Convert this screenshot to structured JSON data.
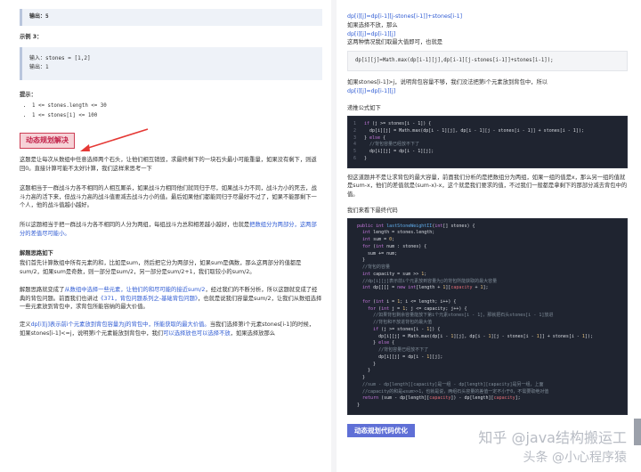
{
  "left": {
    "output5": "输出：5",
    "example3_title": "示例 3：",
    "example3_input": "输入：stones = [1,2]",
    "example3_output": "输出：1",
    "hint_title": "提示：",
    "hints": [
      "1 <= stones.length <= 30",
      "1 <= stones[i] <= 100"
    ],
    "section_title": "动态规划解决",
    "para1": "这题是让每次从数组中任意选择两个石头，让他们相互销毁，求最终剩下的一块石头最小可能重量，如果没有剩下，则返回0。直接计算可能不太好计算，我们这样来思考一下",
    "para2": "这题相当于一群战斗力各不相同的人相互厮杀，如果战斗力相同他们就同归于尽，如果战斗力不同，战斗力小的死去，战斗力高的活下来，但战斗力高的战斗值要减去战斗力小的值。最后如果他们都能同归于尽最好不过了，如果不能那剩下一个人，他的战斗值越小越好。",
    "para3a": "所以这题相当于把一群战斗力各不相同的人分为两组，每组战斗力总和相差越小越好，也就是",
    "para3b": "把数组分为两部分，这两部分的差值尽可能小。",
    "solve_title": "解题思路如下",
    "para4": "我们首先计算数组中所有元素的和，比如是sum，然后把它分为两部分，如果sum是偶数，那么这两部分的值都是sum/2，如果sum是奇数，则一部分是sum/2，另一部分是sum/2+1，我们取较小的sum/2。",
    "para5a": "解题思路就变成了",
    "para5b": "从数组中选择一些元素，让他们的和尽可能的接近sum/2",
    "para5c": "，经过我们的不断分析，所以这题就变成了经典的背包问题。前面我们也讲过",
    "para5d": "《371，背包问题系列之-基础背包问题》",
    "para5e": "，也就是说我们容量是sum/2，让我们从数组选择一些元素放到背包中，求背包所能容纳的最大价值。",
    "para6a": "定义",
    "para6b": "dp[i][j]表示前i个元素放到背包容量为j的背包中，所能获取的最大价值。",
    "para6c": "当我们选择第i个元素stones[i-1]的时候，",
    "para7a": "如果stones[i-1]<=j，说明第i个元素能放到背包中，我们",
    "para7b": "可以选择放也可以选择不放",
    "para7c": "，如果选择放那么"
  },
  "right": {
    "formula1": "dp[i][j]=dp[i-1][j-stones[i-1]]+stones[i-1]",
    "no_put": "如果选择不放，那么",
    "formula2": "dp[i][j]=dp[i-1][j]",
    "take_max": "这两种情况我们取最大值即可，也就是",
    "max_code": "dp[i][j]=Math.max(dp[i-1][j],dp[i-1][j-stones[i-1]]+stones[i-1]);",
    "if_too_big": "如果stones[i-1]>j，说明背包容量不够，我们没法把第i个元素放到背包中，所以",
    "formula3": "dp[i][j]=dp[i-1][j]",
    "recurrence_title": "递推公式如下",
    "para_diff": "但这道题并不是让求背包的最大容量，前面我们分析的是把数组分为两组，如果一组的值是x，那么另一组的值就是sum-x，他们的差值就是(sum-x)-x，这个就是我们要求的值，不过我们一般都是拿剩下的那部分减去背包中的值。",
    "code_title": "我们来看下最终代码",
    "section2": "动态规划代码优化"
  },
  "watermark": {
    "line1": "知乎 @java结构搬运工",
    "line2": "头条 @小心程序猿"
  }
}
